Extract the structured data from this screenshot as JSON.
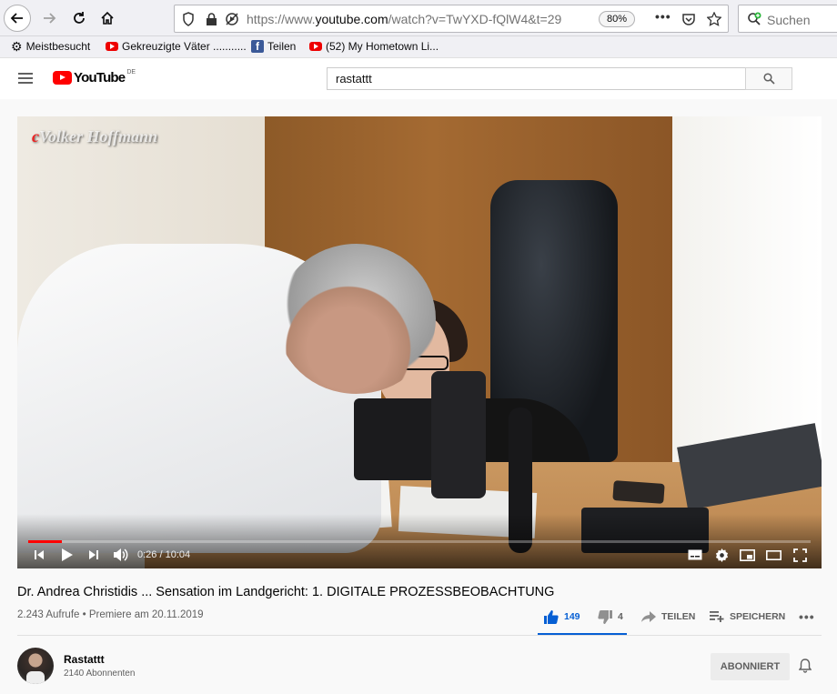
{
  "browser": {
    "url_prefix": "https://www.",
    "url_domain": "youtube.com",
    "url_rest": "/watch?v=TwYXD-fQlW4&t=29",
    "zoom": "80%",
    "search_placeholder": "Suchen",
    "bookmarks": [
      {
        "label": "Meistbesucht",
        "icon": "gear-icon"
      },
      {
        "label": "Gekreuzigte Väter ...........",
        "icon": "youtube-icon"
      },
      {
        "label": "Teilen",
        "icon": "facebook-icon"
      },
      {
        "label": "(52) My Hometown Li...",
        "icon": "youtube-icon"
      }
    ]
  },
  "header": {
    "logo_text": "YouTube",
    "logo_region": "DE",
    "search_value": "rastattt"
  },
  "player": {
    "watermark_c": "c",
    "watermark_name": "Volker Hoffmann",
    "current_time": "0:26",
    "duration": "10:04",
    "progress_fraction": 0.043
  },
  "video": {
    "title": "Dr. Andrea Christidis ... Sensation im Landgericht: 1. DIGITALE PROZESSBEOBACHTUNG",
    "views": "2.243 Aufrufe",
    "premiere": "Premiere am 20.11.2019",
    "likes": "149",
    "dislikes": "4",
    "share_label": "TEILEN",
    "save_label": "SPEICHERN"
  },
  "channel": {
    "name": "Rastattt",
    "subscribers": "2140 Abonnenten",
    "subscribe_label": "ABONNIERT"
  },
  "colors": {
    "accent_blue": "#065fd4",
    "youtube_red": "#ff0000"
  }
}
